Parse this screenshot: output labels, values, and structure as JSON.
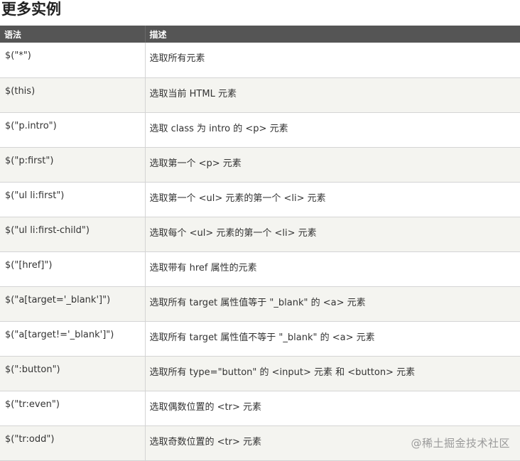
{
  "heading": "更多实例",
  "table": {
    "headers": [
      "语法",
      "描述"
    ],
    "rows": [
      {
        "syntax": "$(\"*\")",
        "description": "选取所有元素"
      },
      {
        "syntax": "$(this)",
        "description": "选取当前 HTML 元素"
      },
      {
        "syntax": "$(\"p.intro\")",
        "description": "选取 class 为 intro 的 <p> 元素"
      },
      {
        "syntax": "$(\"p:first\")",
        "description": "选取第一个 <p> 元素"
      },
      {
        "syntax": "$(\"ul li:first\")",
        "description": "选取第一个 <ul> 元素的第一个 <li> 元素"
      },
      {
        "syntax": "$(\"ul li:first-child\")",
        "description": "选取每个 <ul> 元素的第一个 <li> 元素"
      },
      {
        "syntax": "$(\"[href]\")",
        "description": "选取带有 href 属性的元素"
      },
      {
        "syntax": "$(\"a[target='_blank']\")",
        "description": "选取所有 target 属性值等于 \"_blank\" 的 <a> 元素"
      },
      {
        "syntax": "$(\"a[target!='_blank']\")",
        "description": "选取所有 target 属性值不等于 \"_blank\" 的 <a> 元素"
      },
      {
        "syntax": "$(\":button\")",
        "description": "选取所有 type=\"button\" 的 <input> 元素 和 <button> 元素"
      },
      {
        "syntax": "$(\"tr:even\")",
        "description": "选取偶数位置的 <tr> 元素"
      },
      {
        "syntax": "$(\"tr:odd\")",
        "description": "选取奇数位置的 <tr> 元素"
      }
    ]
  },
  "watermark": "@稀土掘金技术社区",
  "colors": {
    "header_bg": "#555555",
    "stripe_bg": "#f4f4f0",
    "border": "#d4d4d4"
  }
}
